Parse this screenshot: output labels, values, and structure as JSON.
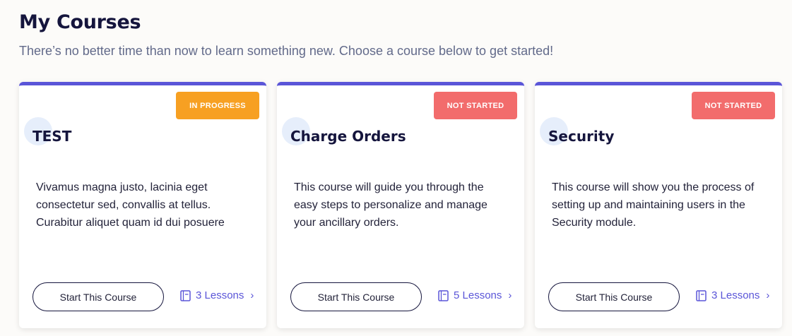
{
  "header": {
    "title": "My Courses",
    "subtitle": "There’s no better time than now to learn something new. Choose a course below to get started!"
  },
  "colors": {
    "accent": "#5a55d8",
    "in_progress": "#f7a022",
    "not_started": "#f26c6c",
    "title": "#15153d"
  },
  "courses": [
    {
      "status": "IN PROGRESS",
      "title": "TEST",
      "description": "Vivamus magna justo, lacinia eget consectetur sed, convallis at tellus. Curabitur aliquet quam id dui posuere",
      "button_label": "Start This Course",
      "lessons_label": "3 Lessons",
      "lessons_icon": "book-icon",
      "chevron": "›"
    },
    {
      "status": "NOT STARTED",
      "title": "Charge Orders",
      "description": "This course will guide you through the easy steps to personalize and manage your ancillary orders.",
      "button_label": "Start This Course",
      "lessons_label": "5 Lessons",
      "lessons_icon": "book-icon",
      "chevron": "›"
    },
    {
      "status": "NOT STARTED",
      "title": "Security",
      "description": "This course will show you the process of setting up and maintaining users in the Security module.",
      "button_label": "Start This Course",
      "lessons_label": "3 Lessons",
      "lessons_icon": "book-icon",
      "chevron": "›"
    }
  ]
}
